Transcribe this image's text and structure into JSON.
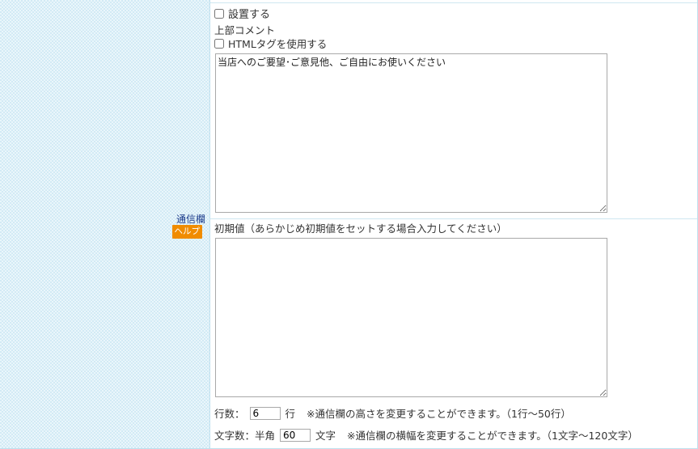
{
  "field": {
    "title": "通信欄",
    "help_label": "ヘルプ"
  },
  "top_section": {
    "setup_checkbox_label": "設置する",
    "setup_checked": false,
    "top_comment_heading": "上部コメント",
    "html_tag_label": "HTMLタグを使用する",
    "html_tag_checked": false,
    "top_comment_value": "当店へのご要望･ご意見他、ご自由にお使いください"
  },
  "bottom_section": {
    "initial_value_label": "初期値（あらかじめ初期値をセットする場合入力してください）",
    "initial_value": "",
    "rows_label": "行数：",
    "rows_value": "6",
    "rows_unit": "行",
    "rows_note": "※通信欄の高さを変更することができます。（1行～50行）",
    "chars_label": "文字数：半角",
    "chars_value": "60",
    "chars_unit": "文字",
    "chars_note": "※通信欄の横幅を変更することができます。（1文字～120文字）"
  },
  "colors": {
    "label_background": "#eaf6fb",
    "field_title": "#1a3a8a",
    "help_badge": "#f08c00",
    "border": "#bfe0ee"
  }
}
